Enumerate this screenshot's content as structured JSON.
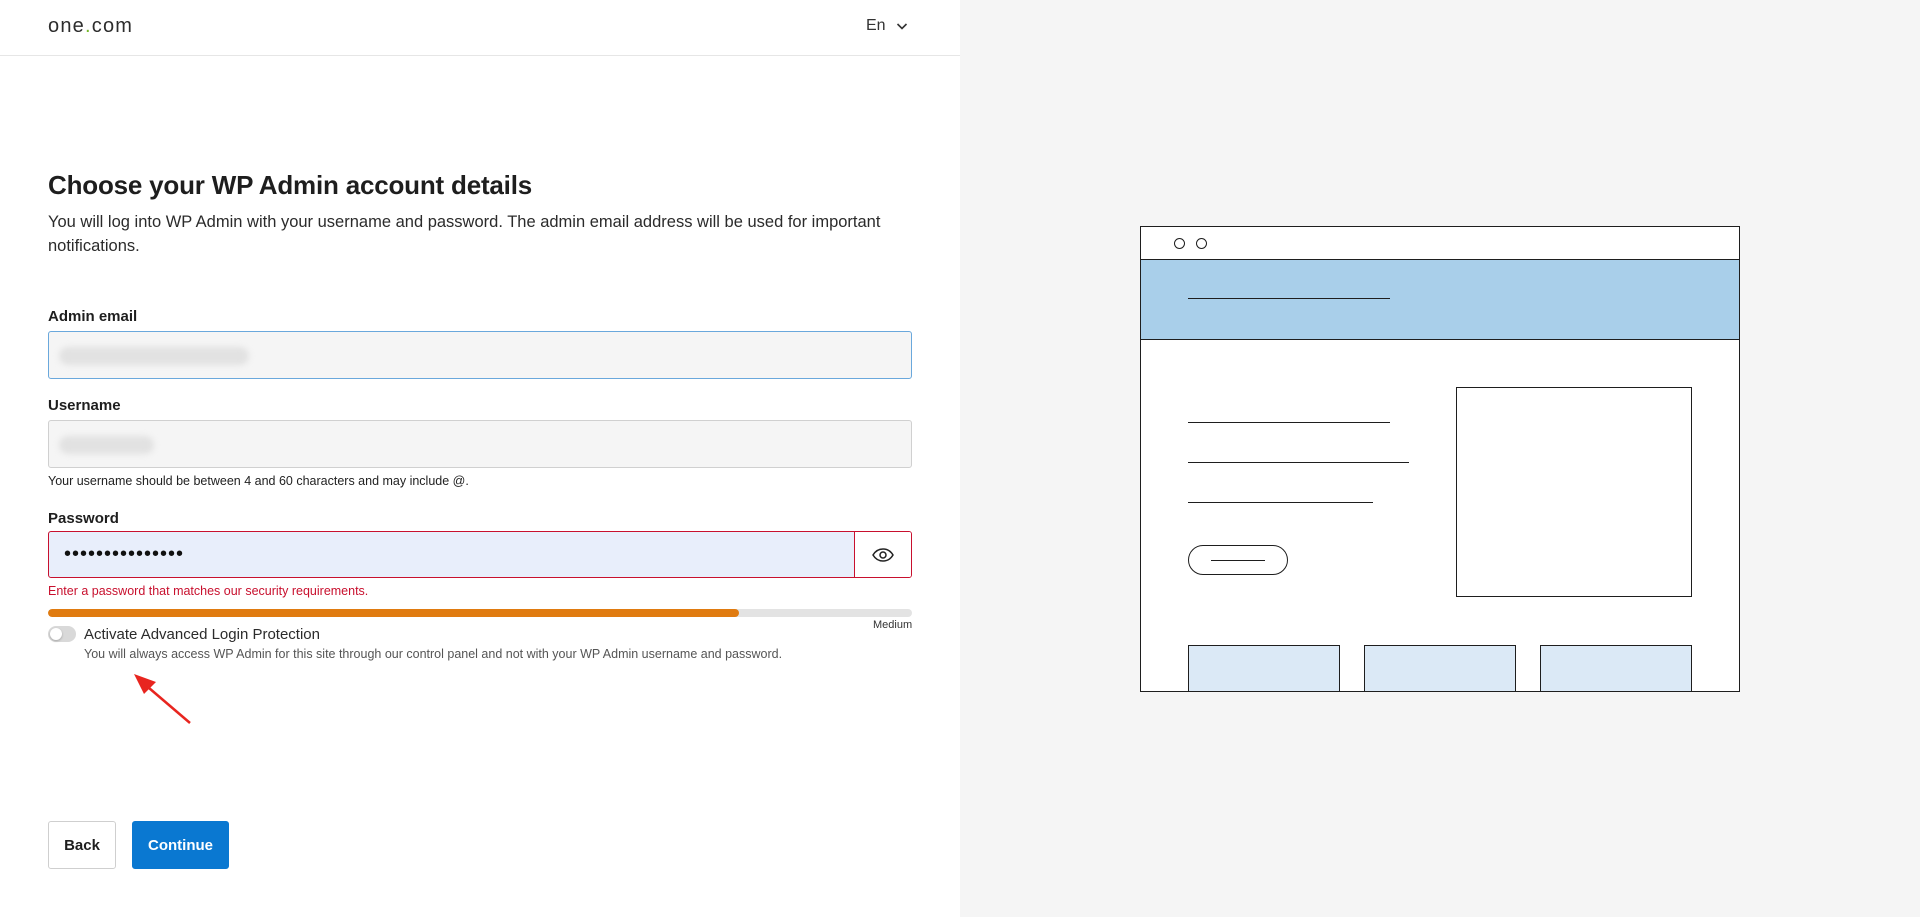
{
  "header": {
    "logo_left": "one",
    "logo_dot": ".",
    "logo_right": "com",
    "language": "En"
  },
  "form": {
    "title": "Choose your WP Admin account details",
    "intro": "You will log into WP Admin with your username and password. The admin email address will be used for important notifications.",
    "email": {
      "label": "Admin email"
    },
    "username": {
      "label": "Username",
      "hint": "Your username should be between 4 and 60 characters and may include @."
    },
    "password": {
      "label": "Password",
      "value": "•••••••••••••••",
      "error": "Enter a password that matches our security requirements.",
      "strength_label": "Medium",
      "strength_fraction": 0.8
    },
    "protection": {
      "label": "Activate Advanced Login Protection",
      "description": "You will always access WP Admin for this site through our control panel and not with your WP Admin username and password.",
      "enabled": false
    }
  },
  "actions": {
    "back": "Back",
    "continue": "Continue"
  },
  "colors": {
    "primary": "#0a78d1",
    "error": "#c8102e",
    "strength_medium": "#e07b10",
    "illustration_header": "#a9cfea",
    "illustration_card": "#dbe9f6"
  }
}
